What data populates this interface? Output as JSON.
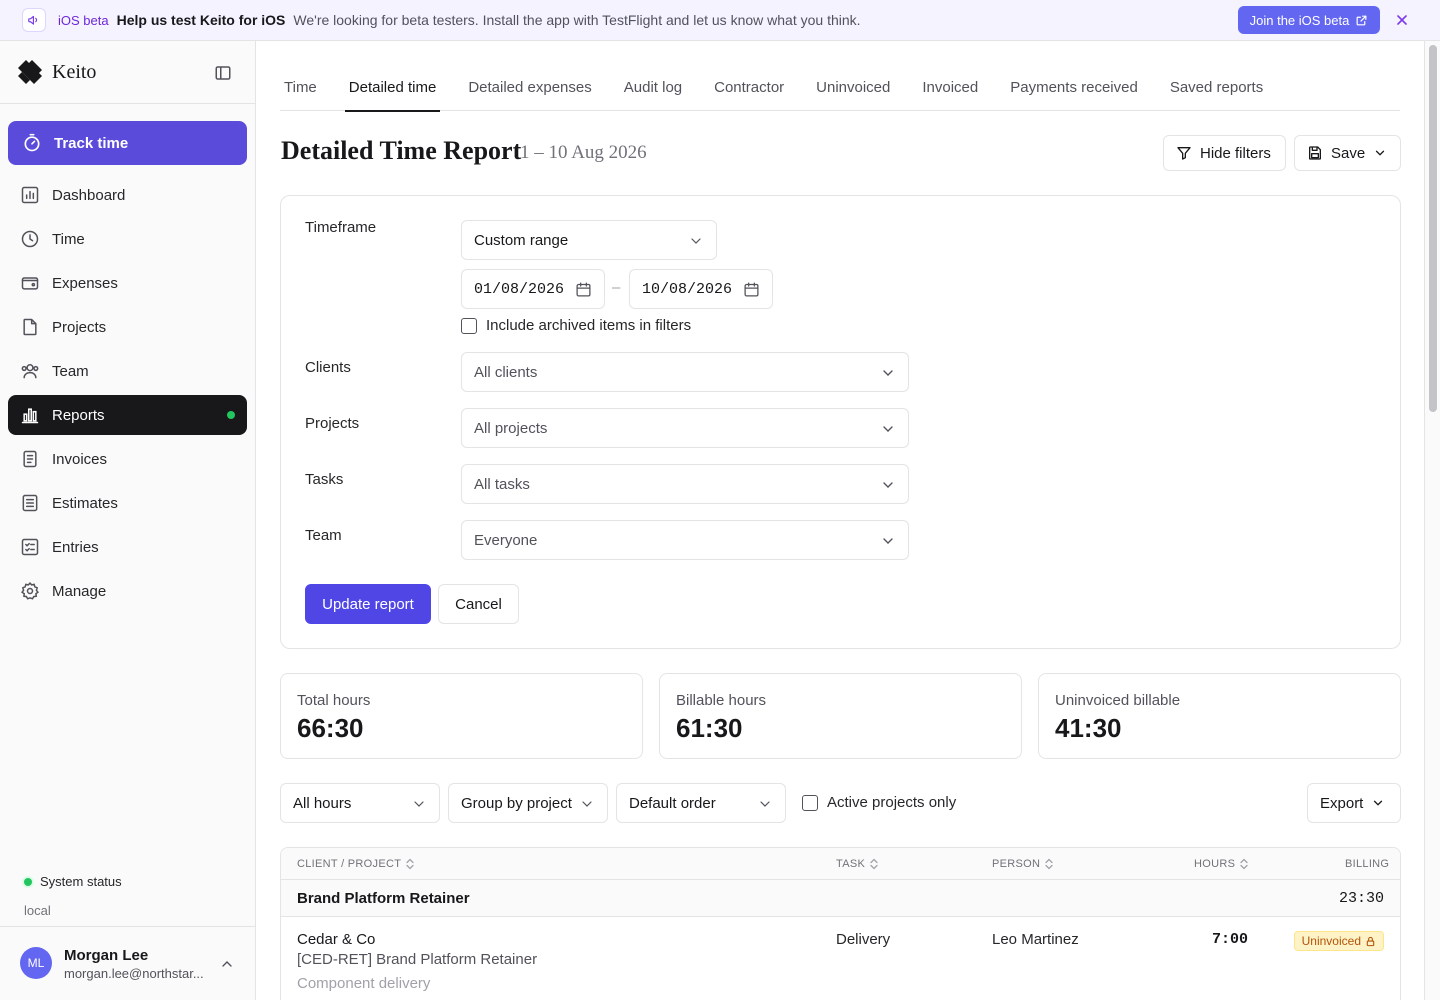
{
  "banner": {
    "tag": "iOS beta",
    "title": "Help us test Keito for iOS",
    "text": "We're looking for beta testers. Install the app with TestFlight and let us know what you think.",
    "cta": "Join the iOS beta"
  },
  "sidebar": {
    "brand": "Keito",
    "track_time": "Track time",
    "items": [
      {
        "label": "Dashboard",
        "icon": "dashboard-icon"
      },
      {
        "label": "Time",
        "icon": "clock-icon"
      },
      {
        "label": "Expenses",
        "icon": "wallet-icon"
      },
      {
        "label": "Projects",
        "icon": "folder-icon"
      },
      {
        "label": "Team",
        "icon": "users-icon"
      },
      {
        "label": "Reports",
        "icon": "bar-chart-icon",
        "active": true
      },
      {
        "label": "Invoices",
        "icon": "invoice-icon"
      },
      {
        "label": "Estimates",
        "icon": "estimate-icon"
      },
      {
        "label": "Entries",
        "icon": "list-icon"
      },
      {
        "label": "Manage",
        "icon": "gear-icon"
      }
    ],
    "system_status": "System status",
    "environment": "local",
    "user": {
      "initials": "ML",
      "name": "Morgan Lee",
      "email": "morgan.lee@northstar..."
    }
  },
  "tabs": [
    "Time",
    "Detailed time",
    "Detailed expenses",
    "Audit log",
    "Contractor",
    "Uninvoiced",
    "Invoiced",
    "Payments received",
    "Saved reports"
  ],
  "active_tab": "Detailed time",
  "header": {
    "title": "Detailed Time Report",
    "range": "1 – 10 Aug 2026",
    "hide_filters": "Hide filters",
    "save": "Save"
  },
  "filters": {
    "timeframe_label": "Timeframe",
    "timeframe_value": "Custom range",
    "date_from": "01/08/2026",
    "date_sep": "–",
    "date_to": "10/08/2026",
    "include_archived": "Include archived items in filters",
    "clients_label": "Clients",
    "clients_value": "All clients",
    "projects_label": "Projects",
    "projects_value": "All projects",
    "tasks_label": "Tasks",
    "tasks_value": "All tasks",
    "team_label": "Team",
    "team_value": "Everyone",
    "update": "Update report",
    "cancel": "Cancel"
  },
  "stats": [
    {
      "label": "Total hours",
      "value": "66:30"
    },
    {
      "label": "Billable hours",
      "value": "61:30"
    },
    {
      "label": "Uninvoiced billable",
      "value": "41:30"
    }
  ],
  "toolbar": {
    "hours": "All hours",
    "group": "Group by project",
    "order": "Default order",
    "active_only": "Active projects only",
    "export": "Export"
  },
  "table": {
    "columns": [
      "CLIENT / PROJECT",
      "TASK",
      "PERSON",
      "HOURS",
      "BILLING"
    ],
    "group": {
      "name": "Brand Platform Retainer",
      "hours": "23:30"
    },
    "rows": [
      {
        "client": "Cedar & Co",
        "project": "[CED-RET] Brand Platform Retainer",
        "note": "Component delivery",
        "task": "Delivery",
        "person": "Leo Martinez",
        "hours": "7:00",
        "billing": "Uninvoiced"
      }
    ]
  }
}
